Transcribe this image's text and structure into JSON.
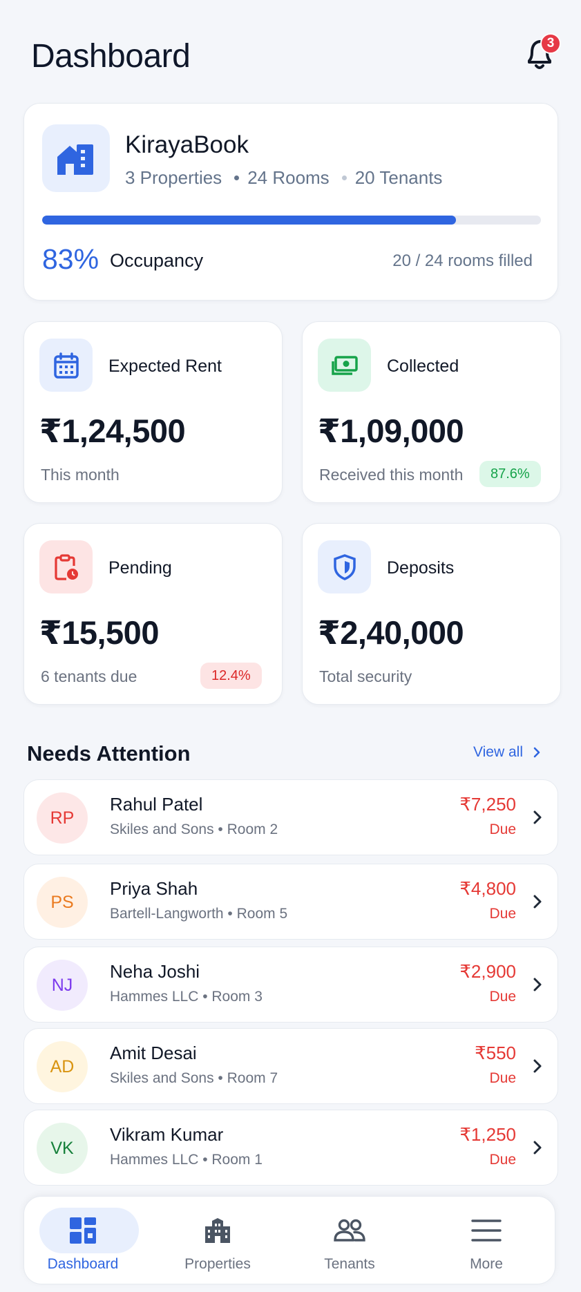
{
  "header": {
    "title": "Dashboard",
    "notification_count": "3"
  },
  "summary": {
    "name": "KirayaBook",
    "properties": "3 Properties",
    "rooms": "24 Rooms",
    "tenants": "20 Tenants",
    "occupancy_pct": "83%",
    "occupancy_fraction": 0.83,
    "occupancy_label": "Occupancy",
    "rooms_filled": "20 / 24 rooms filled"
  },
  "stats": {
    "expected": {
      "title": "Expected Rent",
      "amount": "₹1,24,500",
      "sub": "This month"
    },
    "collected": {
      "title": "Collected",
      "amount": "₹1,09,000",
      "sub": "Received this month",
      "badge": "87.6%"
    },
    "pending": {
      "title": "Pending",
      "amount": "₹15,500",
      "sub": "6 tenants due",
      "badge": "12.4%"
    },
    "deposits": {
      "title": "Deposits",
      "amount": "₹2,40,000",
      "sub": "Total security"
    }
  },
  "attention": {
    "title": "Needs Attention",
    "view_all": "View all",
    "items": [
      {
        "initials": "RP",
        "name": "Rahul Patel",
        "sub": "Skiles and Sons • Room 2",
        "amount": "₹7,250",
        "status": "Due"
      },
      {
        "initials": "PS",
        "name": "Priya Shah",
        "sub": "Bartell-Langworth • Room 5",
        "amount": "₹4,800",
        "status": "Due"
      },
      {
        "initials": "NJ",
        "name": "Neha Joshi",
        "sub": "Hammes LLC • Room 3",
        "amount": "₹2,900",
        "status": "Due"
      },
      {
        "initials": "AD",
        "name": "Amit Desai",
        "sub": "Skiles and Sons • Room 7",
        "amount": "₹550",
        "status": "Due"
      },
      {
        "initials": "VK",
        "name": "Vikram Kumar",
        "sub": "Hammes LLC • Room 1",
        "amount": "₹1,250",
        "status": "Due"
      }
    ]
  },
  "nav": {
    "items": [
      {
        "label": "Dashboard",
        "icon": "dashboard-icon",
        "active": true
      },
      {
        "label": "Properties",
        "icon": "building-icon",
        "active": false
      },
      {
        "label": "Tenants",
        "icon": "people-icon",
        "active": false
      },
      {
        "label": "More",
        "icon": "menu-icon",
        "active": false
      }
    ]
  },
  "colors": {
    "accent": "#2f65e0",
    "danger": "#e53935",
    "success": "#16a34a"
  }
}
